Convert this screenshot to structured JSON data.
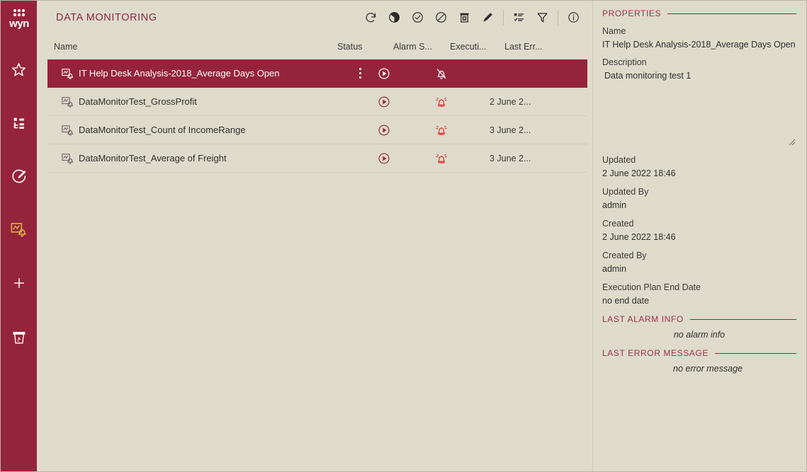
{
  "brand": {
    "logo_text": "wyn",
    "accent": "#96233c",
    "active_icon": "#e0b844",
    "alarm_red": "#e8262c",
    "background": "#dedbcb"
  },
  "sidebar": {
    "items": [
      {
        "name": "logo",
        "icon": "wyn-logo-icon",
        "label": "wyn",
        "active": false
      },
      {
        "name": "favorites",
        "icon": "star-icon",
        "label": "Favorites",
        "active": false
      },
      {
        "name": "resources",
        "icon": "resource-tree-icon",
        "label": "Resource Portal",
        "active": false
      },
      {
        "name": "create",
        "icon": "create-pencil-circle-icon",
        "label": "Create",
        "active": false
      },
      {
        "name": "data-monitoring",
        "icon": "data-monitoring-icon",
        "label": "Data Monitoring",
        "active": true
      },
      {
        "name": "add",
        "icon": "plus-icon",
        "label": "Add",
        "active": false
      },
      {
        "name": "recycle-bin",
        "icon": "recycle-bin-icon",
        "label": "Recycle Bin",
        "active": false
      }
    ]
  },
  "header": {
    "title": "DATA MONITORING",
    "toolbar": [
      {
        "name": "refresh-button",
        "icon": "refresh-icon",
        "label": "Refresh"
      },
      {
        "name": "chart-button",
        "icon": "pie-chart-icon",
        "label": "Chart"
      },
      {
        "name": "enable-button",
        "icon": "check-circle-icon",
        "label": "Enable"
      },
      {
        "name": "disable-button",
        "icon": "ban-circle-icon",
        "label": "Disable"
      },
      {
        "name": "delete-button",
        "icon": "trash-icon",
        "label": "Delete"
      },
      {
        "name": "edit-button",
        "icon": "pencil-icon",
        "label": "Edit"
      },
      {
        "name": "separator-1",
        "icon": "separator",
        "label": ""
      },
      {
        "name": "columns-button",
        "icon": "list-check-icon",
        "label": "Columns"
      },
      {
        "name": "filter-button",
        "icon": "filter-icon",
        "label": "Filter"
      },
      {
        "name": "separator-2",
        "icon": "separator",
        "label": ""
      },
      {
        "name": "info-button",
        "icon": "info-circle-icon",
        "label": "Info"
      }
    ]
  },
  "table": {
    "columns": [
      {
        "key": "name",
        "label": "Name"
      },
      {
        "key": "status",
        "label": "Status"
      },
      {
        "key": "alarm",
        "label": "Alarm S..."
      },
      {
        "key": "execution",
        "label": "Executi..."
      },
      {
        "key": "error",
        "label": "Last Err..."
      }
    ],
    "rows": [
      {
        "name": "IT Help Desk Analysis-2018_Average Days Open",
        "icon": "data-monitor-icon",
        "status_icon": "play-circle-icon",
        "alarm_icon": "bell-off-icon",
        "execution": "",
        "error": "",
        "selected": true
      },
      {
        "name": "DataMonitorTest_GrossProfit",
        "icon": "data-monitor-icon",
        "status_icon": "play-circle-icon",
        "alarm_icon": "bell-ringing-icon",
        "execution": "2 June 2...",
        "error": "",
        "selected": false
      },
      {
        "name": "DataMonitorTest_Count of IncomeRange",
        "icon": "data-monitor-icon",
        "status_icon": "play-circle-icon",
        "alarm_icon": "bell-ringing-icon",
        "execution": "3 June 2...",
        "error": "",
        "selected": false
      },
      {
        "name": "DataMonitorTest_Average of Freight",
        "icon": "data-monitor-icon",
        "status_icon": "play-circle-icon",
        "alarm_icon": "bell-ringing-icon",
        "execution": "3 June 2...",
        "error": "",
        "selected": false
      }
    ]
  },
  "properties": {
    "section_title": "PROPERTIES",
    "name_label": "Name",
    "name_value": "IT Help Desk Analysis-2018_Average Days Open",
    "description_label": "Description",
    "description_value": "Data monitoring test 1",
    "updated_label": "Updated",
    "updated_value": "2 June 2022 18:46",
    "updated_by_label": "Updated By",
    "updated_by_value": "admin",
    "created_label": "Created",
    "created_value": "2 June 2022 18:46",
    "created_by_label": "Created By",
    "created_by_value": "admin",
    "plan_end_label": "Execution Plan End Date",
    "plan_end_value": "no end date",
    "alarm_section_title": "LAST ALARM INFO",
    "alarm_empty": "no alarm info",
    "error_section_title": "LAST ERROR MESSAGE",
    "error_empty": "no error message"
  }
}
